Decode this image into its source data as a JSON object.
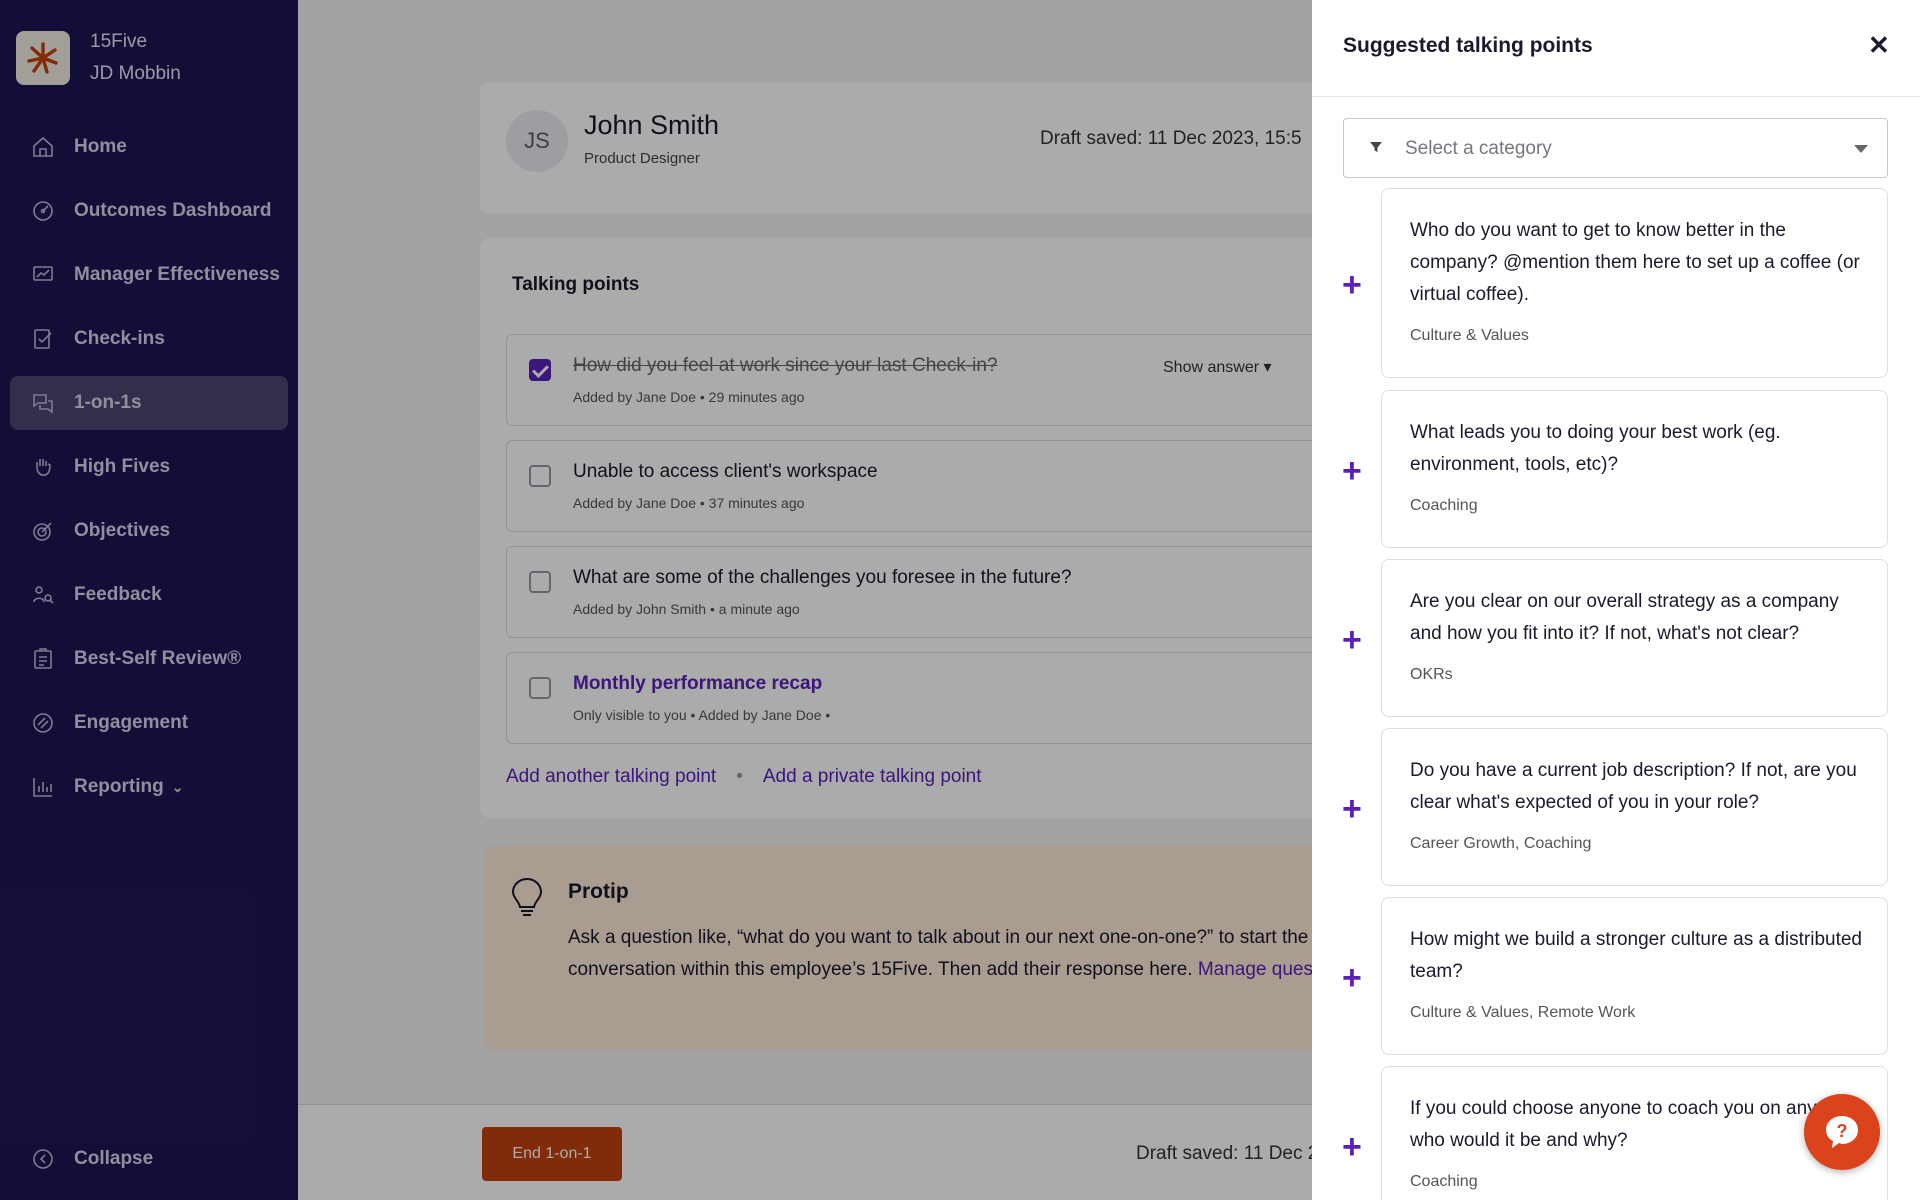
{
  "brand": {
    "company": "15Five",
    "user": "JD Mobbin"
  },
  "sidebar": {
    "items": [
      {
        "label": "Home",
        "icon": "home-icon"
      },
      {
        "label": "Outcomes Dashboard",
        "icon": "dashboard-icon"
      },
      {
        "label": "Manager Effectiveness",
        "icon": "manager-icon"
      },
      {
        "label": "Check-ins",
        "icon": "checkin-icon"
      },
      {
        "label": "1-on-1s",
        "icon": "chat-icon",
        "active": true
      },
      {
        "label": "High Fives",
        "icon": "high-five-icon"
      },
      {
        "label": "Objectives",
        "icon": "target-icon"
      },
      {
        "label": "Feedback",
        "icon": "feedback-icon"
      },
      {
        "label": "Best-Self Review®",
        "icon": "review-icon"
      },
      {
        "label": "Engagement",
        "icon": "engagement-icon"
      },
      {
        "label": "Reporting",
        "icon": "chart-icon"
      }
    ],
    "collapse_label": "Collapse"
  },
  "header": {
    "initials": "JS",
    "name": "John Smith",
    "role": "Product Designer",
    "draft_status": "Draft saved: 11 Dec 2023, 15:5"
  },
  "talking_points": {
    "title": "Talking points",
    "show_answer": "Show answer",
    "items": [
      {
        "text": "How did you feel at work since your last Check-in?",
        "meta": "Added by Jane Doe  •  29 minutes ago",
        "checked": true
      },
      {
        "text": "Unable to access client's workspace",
        "meta": "Added by Jane Doe  •  37 minutes ago",
        "checked": false
      },
      {
        "text": "What are some of the challenges you foresee in the future?",
        "meta": "Added by John Smith  •  a minute ago",
        "checked": false
      },
      {
        "text": "Monthly performance recap",
        "meta": "Only visible to you  •  Added by Jane Doe  •",
        "checked": false,
        "private": true
      }
    ],
    "add_link": "Add another talking point",
    "add_private_link": "Add a private talking point"
  },
  "protip": {
    "title": "Protip",
    "body": "Ask a question like, “what do you want to talk about in our next one-on-one?” to start the conversation within this employee’s 15Five. Then add their response here.",
    "link": "Manage questions"
  },
  "footer": {
    "end_button": "End 1-on-1",
    "draft_status": "Draft saved: 11 Dec 2"
  },
  "panel": {
    "title": "Suggested talking points",
    "filter_placeholder": "Select a category",
    "suggestions": [
      {
        "question": "Who do you want to get to know better in the company? @mention them here to set up a coffee (or virtual coffee).",
        "category": "Culture & Values"
      },
      {
        "question": "What leads you to doing your best work (eg. environment, tools, etc)?",
        "category": "Coaching"
      },
      {
        "question": "Are you clear on our overall strategy as a company and how you fit into it? If not, what's not clear?",
        "category": "OKRs"
      },
      {
        "question": "Do you have a current job description? If not, are you clear what's expected of you in your role?",
        "category": "Career Growth, Coaching"
      },
      {
        "question": "How might we build a stronger culture as a distributed team?",
        "category": "Culture & Values, Remote Work"
      },
      {
        "question": "If you could choose anyone to coach you on any topic, who would it be and why?",
        "category": "Coaching"
      }
    ]
  },
  "colors": {
    "sidebar": "#1c1653",
    "accent": "#5b21b6",
    "end_button": "#c2410c",
    "help_button": "#d9441d"
  }
}
